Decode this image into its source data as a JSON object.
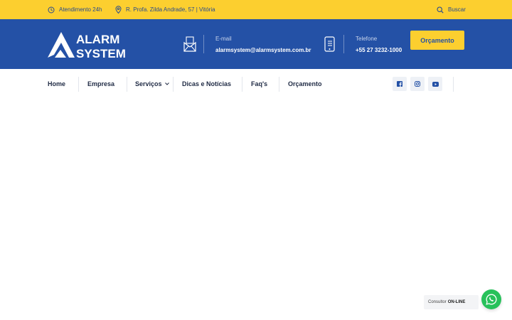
{
  "topbar": {
    "hours": "Atendimento 24h",
    "address": "R. Profa. Zilda Andrade, 57 | Vitória",
    "search": "Buscar",
    "icons": {
      "hours": "clock-icon",
      "address": "map-pin-icon",
      "search": "search-icon"
    }
  },
  "header": {
    "logo": {
      "line1": "ALARM",
      "line2": "SYSTEM"
    },
    "email": {
      "label": "E-mail",
      "value": "alarmsystem@alarmsystem.com.br",
      "icon": "envelope-icon"
    },
    "phone": {
      "label": "Telefone",
      "value": "+55 27 3232-1000",
      "icon": "mobile-phone-icon"
    },
    "quote_button": "Orçamento"
  },
  "nav": {
    "items": [
      {
        "label": "Home"
      },
      {
        "label": "Empresa"
      },
      {
        "label": "Serviços",
        "has_dropdown": true
      },
      {
        "label": "Dicas e Notícias"
      },
      {
        "label": "Faq's"
      },
      {
        "label": "Orçamento"
      }
    ],
    "social": [
      "facebook-icon",
      "instagram-icon",
      "youtube-icon"
    ]
  },
  "whatsapp": {
    "label_prefix": "Consultor",
    "label_status": "ON-LINE",
    "icon": "whatsapp-icon"
  },
  "colors": {
    "yellow": "#fccf2f",
    "blue": "#2451a6",
    "navy_text": "#1f2a44",
    "whatsapp_green": "#27c15a"
  }
}
